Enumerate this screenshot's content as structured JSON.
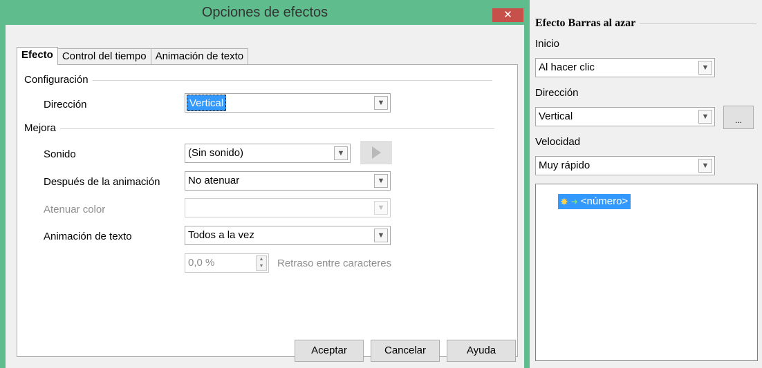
{
  "dialog": {
    "title": "Opciones de efectos",
    "close_glyph": "✕",
    "tabs": [
      {
        "label": "Efecto",
        "active": true
      },
      {
        "label": "Control del tiempo",
        "active": false
      },
      {
        "label": "Animación de texto",
        "active": false
      }
    ],
    "configuracion": {
      "group_label": "Configuración",
      "direccion_label": "Dirección",
      "direccion_value": "Vertical"
    },
    "mejora": {
      "group_label": "Mejora",
      "sonido_label": "Sonido",
      "sonido_value": "(Sin sonido)",
      "despues_label": "Después de la animación",
      "despues_value": "No atenuar",
      "atenuar_label": "Atenuar color",
      "atenuar_value": "",
      "animacion_texto_label": "Animación de texto",
      "animacion_texto_value": "Todos a la vez",
      "retraso_value": "0,0 %",
      "retraso_label": "Retraso entre caracteres"
    },
    "buttons": {
      "aceptar": "Aceptar",
      "cancelar": "Cancelar",
      "ayuda": "Ayuda"
    }
  },
  "sidebar": {
    "heading": "Efecto Barras al azar",
    "inicio_label": "Inicio",
    "inicio_value": "Al hacer clic",
    "direccion_label": "Dirección",
    "direccion_value": "Vertical",
    "more_button": "...",
    "velocidad_label": "Velocidad",
    "velocidad_value": "Muy rápido",
    "animation_list": [
      {
        "label": "<número>",
        "icons": [
          "effect-spark-icon",
          "entrance-arrow-icon"
        ]
      }
    ]
  },
  "colors": {
    "window_frame": "#5fbd8d",
    "close_button": "#c7514a",
    "selection": "#3399ff"
  }
}
